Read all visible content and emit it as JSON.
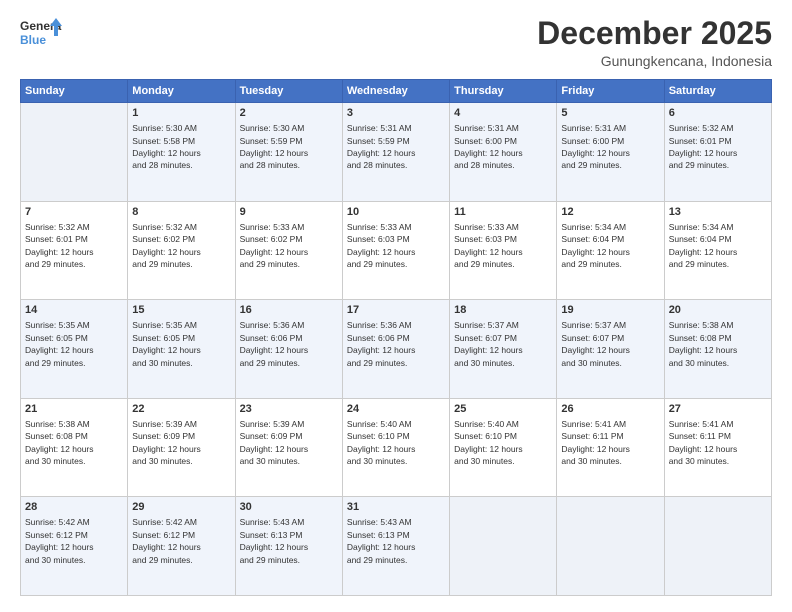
{
  "logo": {
    "line1": "General",
    "line2": "Blue"
  },
  "title": "December 2025",
  "subtitle": "Gunungkencana, Indonesia",
  "days_header": [
    "Sunday",
    "Monday",
    "Tuesday",
    "Wednesday",
    "Thursday",
    "Friday",
    "Saturday"
  ],
  "weeks": [
    [
      {
        "day": "",
        "empty": true
      },
      {
        "day": "1",
        "sunrise": "5:30 AM",
        "sunset": "5:58 PM",
        "daylight": "12 hours and 28 minutes."
      },
      {
        "day": "2",
        "sunrise": "5:30 AM",
        "sunset": "5:59 PM",
        "daylight": "12 hours and 28 minutes."
      },
      {
        "day": "3",
        "sunrise": "5:31 AM",
        "sunset": "5:59 PM",
        "daylight": "12 hours and 28 minutes."
      },
      {
        "day": "4",
        "sunrise": "5:31 AM",
        "sunset": "6:00 PM",
        "daylight": "12 hours and 28 minutes."
      },
      {
        "day": "5",
        "sunrise": "5:31 AM",
        "sunset": "6:00 PM",
        "daylight": "12 hours and 29 minutes."
      },
      {
        "day": "6",
        "sunrise": "5:32 AM",
        "sunset": "6:01 PM",
        "daylight": "12 hours and 29 minutes."
      }
    ],
    [
      {
        "day": "7",
        "sunrise": "5:32 AM",
        "sunset": "6:01 PM",
        "daylight": "12 hours and 29 minutes."
      },
      {
        "day": "8",
        "sunrise": "5:32 AM",
        "sunset": "6:02 PM",
        "daylight": "12 hours and 29 minutes."
      },
      {
        "day": "9",
        "sunrise": "5:33 AM",
        "sunset": "6:02 PM",
        "daylight": "12 hours and 29 minutes."
      },
      {
        "day": "10",
        "sunrise": "5:33 AM",
        "sunset": "6:03 PM",
        "daylight": "12 hours and 29 minutes."
      },
      {
        "day": "11",
        "sunrise": "5:33 AM",
        "sunset": "6:03 PM",
        "daylight": "12 hours and 29 minutes."
      },
      {
        "day": "12",
        "sunrise": "5:34 AM",
        "sunset": "6:04 PM",
        "daylight": "12 hours and 29 minutes."
      },
      {
        "day": "13",
        "sunrise": "5:34 AM",
        "sunset": "6:04 PM",
        "daylight": "12 hours and 29 minutes."
      }
    ],
    [
      {
        "day": "14",
        "sunrise": "5:35 AM",
        "sunset": "6:05 PM",
        "daylight": "12 hours and 29 minutes."
      },
      {
        "day": "15",
        "sunrise": "5:35 AM",
        "sunset": "6:05 PM",
        "daylight": "12 hours and 30 minutes."
      },
      {
        "day": "16",
        "sunrise": "5:36 AM",
        "sunset": "6:06 PM",
        "daylight": "12 hours and 29 minutes."
      },
      {
        "day": "17",
        "sunrise": "5:36 AM",
        "sunset": "6:06 PM",
        "daylight": "12 hours and 29 minutes."
      },
      {
        "day": "18",
        "sunrise": "5:37 AM",
        "sunset": "6:07 PM",
        "daylight": "12 hours and 30 minutes."
      },
      {
        "day": "19",
        "sunrise": "5:37 AM",
        "sunset": "6:07 PM",
        "daylight": "12 hours and 30 minutes."
      },
      {
        "day": "20",
        "sunrise": "5:38 AM",
        "sunset": "6:08 PM",
        "daylight": "12 hours and 30 minutes."
      }
    ],
    [
      {
        "day": "21",
        "sunrise": "5:38 AM",
        "sunset": "6:08 PM",
        "daylight": "12 hours and 30 minutes."
      },
      {
        "day": "22",
        "sunrise": "5:39 AM",
        "sunset": "6:09 PM",
        "daylight": "12 hours and 30 minutes."
      },
      {
        "day": "23",
        "sunrise": "5:39 AM",
        "sunset": "6:09 PM",
        "daylight": "12 hours and 30 minutes."
      },
      {
        "day": "24",
        "sunrise": "5:40 AM",
        "sunset": "6:10 PM",
        "daylight": "12 hours and 30 minutes."
      },
      {
        "day": "25",
        "sunrise": "5:40 AM",
        "sunset": "6:10 PM",
        "daylight": "12 hours and 30 minutes."
      },
      {
        "day": "26",
        "sunrise": "5:41 AM",
        "sunset": "6:11 PM",
        "daylight": "12 hours and 30 minutes."
      },
      {
        "day": "27",
        "sunrise": "5:41 AM",
        "sunset": "6:11 PM",
        "daylight": "12 hours and 30 minutes."
      }
    ],
    [
      {
        "day": "28",
        "sunrise": "5:42 AM",
        "sunset": "6:12 PM",
        "daylight": "12 hours and 30 minutes."
      },
      {
        "day": "29",
        "sunrise": "5:42 AM",
        "sunset": "6:12 PM",
        "daylight": "12 hours and 29 minutes."
      },
      {
        "day": "30",
        "sunrise": "5:43 AM",
        "sunset": "6:13 PM",
        "daylight": "12 hours and 29 minutes."
      },
      {
        "day": "31",
        "sunrise": "5:43 AM",
        "sunset": "6:13 PM",
        "daylight": "12 hours and 29 minutes."
      },
      {
        "day": "",
        "empty": true
      },
      {
        "day": "",
        "empty": true
      },
      {
        "day": "",
        "empty": true
      }
    ]
  ],
  "labels": {
    "sunrise": "Sunrise:",
    "sunset": "Sunset:",
    "daylight": "Daylight:"
  }
}
